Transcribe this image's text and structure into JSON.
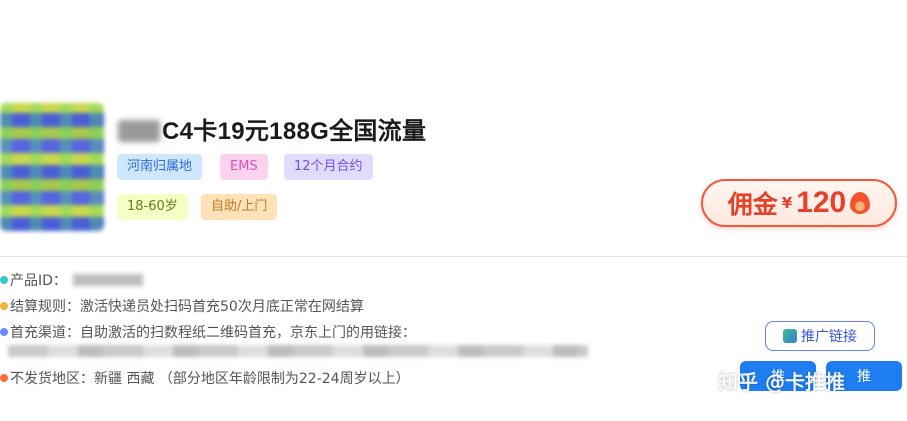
{
  "product": {
    "title": "C4卡19元188G全国流量",
    "tags_row1": [
      "河南归属地",
      "EMS",
      "12个月合约"
    ],
    "tags_row2": [
      "18-60岁",
      "自助/上门"
    ]
  },
  "commission": {
    "label": "佣金",
    "currency": "¥",
    "amount": "120"
  },
  "details": {
    "product_id_label": "产品ID：",
    "settlement": "结算规则：激活快递员处扫码首充50次月底正常在网结算",
    "first_charge": "首充渠道：自助激活的扫数程纸二维码首充，京东上门的用链接：",
    "no_ship": "不发货地区：新疆  西藏  （部分地区年龄限制为22-24周岁以上）"
  },
  "actions": {
    "promo_link": "推广链接",
    "button1": "推",
    "button2": "推"
  },
  "watermark": "知乎 @卡推推",
  "colors": {
    "commission_red": "#e8412b",
    "primary_blue": "#1e7df0"
  }
}
